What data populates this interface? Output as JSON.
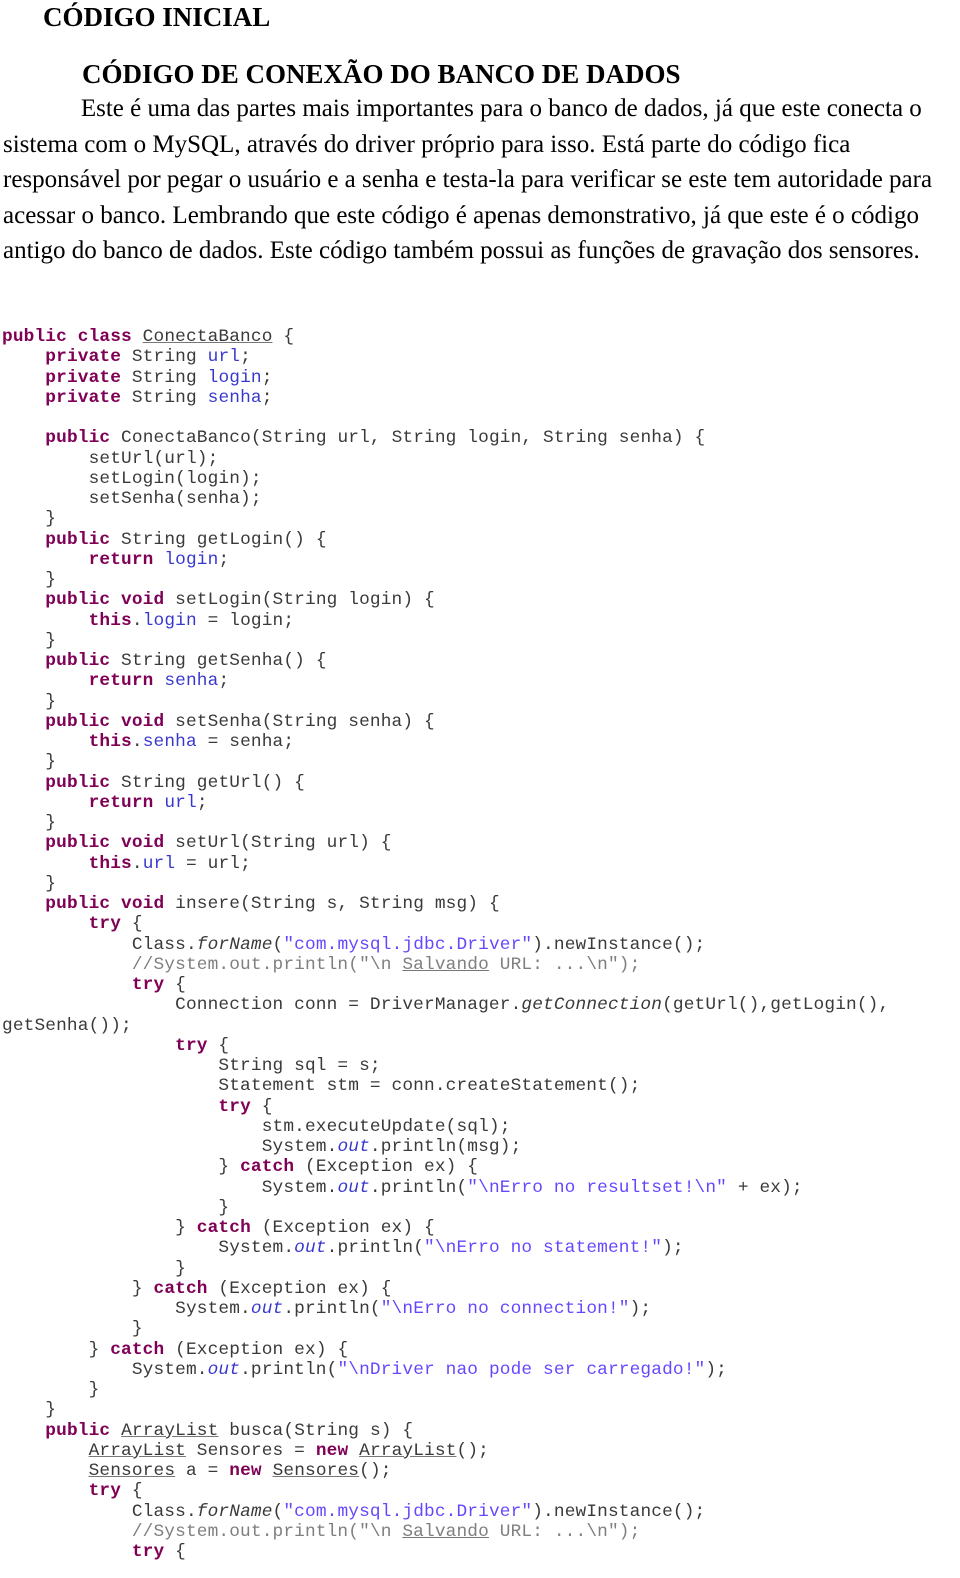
{
  "document": {
    "heading": "CÓDIGO INICIAL",
    "subheading": "CÓDIGO DE CONEXÃO DO BANCO DE DADOS",
    "paragraph": "Este é uma das partes mais importantes para o banco de dados, já que este conecta o sistema com o MySQL, através do driver próprio para isso. Está parte do código fica responsável por pegar o usuário e a senha e testa-la para verificar se este tem autoridade para acessar o banco. Lembrando que este código é apenas demonstrativo, já que este é o código antigo do banco de dados. Este código também possui as funções de gravação dos sensores."
  },
  "code": {
    "language": "java",
    "lines": [
      [
        {
          "t": "public class ",
          "c": "kw"
        },
        {
          "t": "ConectaBanco",
          "c": "ul"
        },
        {
          "t": " {"
        }
      ],
      [
        {
          "t": "    "
        },
        {
          "t": "private",
          "c": "kw"
        },
        {
          "t": " String "
        },
        {
          "t": "url",
          "c": "fld"
        },
        {
          "t": ";"
        }
      ],
      [
        {
          "t": "    "
        },
        {
          "t": "private",
          "c": "kw"
        },
        {
          "t": " String "
        },
        {
          "t": "login",
          "c": "fld"
        },
        {
          "t": ";"
        }
      ],
      [
        {
          "t": "    "
        },
        {
          "t": "private",
          "c": "kw"
        },
        {
          "t": " String "
        },
        {
          "t": "senha",
          "c": "fld"
        },
        {
          "t": ";"
        }
      ],
      [
        {
          "t": ""
        }
      ],
      [
        {
          "t": "    "
        },
        {
          "t": "public",
          "c": "kw"
        },
        {
          "t": " ConectaBanco(String url, String login, String senha) {"
        }
      ],
      [
        {
          "t": "        setUrl(url);"
        }
      ],
      [
        {
          "t": "        setLogin(login);"
        }
      ],
      [
        {
          "t": "        setSenha(senha);"
        }
      ],
      [
        {
          "t": "    }"
        }
      ],
      [
        {
          "t": "    "
        },
        {
          "t": "public",
          "c": "kw"
        },
        {
          "t": " String getLogin() {"
        }
      ],
      [
        {
          "t": "        "
        },
        {
          "t": "return",
          "c": "kw"
        },
        {
          "t": " "
        },
        {
          "t": "login",
          "c": "fld"
        },
        {
          "t": ";"
        }
      ],
      [
        {
          "t": "    }"
        }
      ],
      [
        {
          "t": "    "
        },
        {
          "t": "public void",
          "c": "kw"
        },
        {
          "t": " setLogin(String login) {"
        }
      ],
      [
        {
          "t": "        "
        },
        {
          "t": "this",
          "c": "kw"
        },
        {
          "t": "."
        },
        {
          "t": "login",
          "c": "fld"
        },
        {
          "t": " = login;"
        }
      ],
      [
        {
          "t": "    }"
        }
      ],
      [
        {
          "t": "    "
        },
        {
          "t": "public",
          "c": "kw"
        },
        {
          "t": " String getSenha() {"
        }
      ],
      [
        {
          "t": "        "
        },
        {
          "t": "return",
          "c": "kw"
        },
        {
          "t": " "
        },
        {
          "t": "senha",
          "c": "fld"
        },
        {
          "t": ";"
        }
      ],
      [
        {
          "t": "    }"
        }
      ],
      [
        {
          "t": "    "
        },
        {
          "t": "public void",
          "c": "kw"
        },
        {
          "t": " setSenha(String senha) {"
        }
      ],
      [
        {
          "t": "        "
        },
        {
          "t": "this",
          "c": "kw"
        },
        {
          "t": "."
        },
        {
          "t": "senha",
          "c": "fld"
        },
        {
          "t": " = senha;"
        }
      ],
      [
        {
          "t": "    }"
        }
      ],
      [
        {
          "t": "    "
        },
        {
          "t": "public",
          "c": "kw"
        },
        {
          "t": " String getUrl() {"
        }
      ],
      [
        {
          "t": "        "
        },
        {
          "t": "return",
          "c": "kw"
        },
        {
          "t": " "
        },
        {
          "t": "url",
          "c": "fld"
        },
        {
          "t": ";"
        }
      ],
      [
        {
          "t": "    }"
        }
      ],
      [
        {
          "t": "    "
        },
        {
          "t": "public void",
          "c": "kw"
        },
        {
          "t": " setUrl(String url) {"
        }
      ],
      [
        {
          "t": "        "
        },
        {
          "t": "this",
          "c": "kw"
        },
        {
          "t": "."
        },
        {
          "t": "url",
          "c": "fld"
        },
        {
          "t": " = url;"
        }
      ],
      [
        {
          "t": "    }"
        }
      ],
      [
        {
          "t": "    "
        },
        {
          "t": "public void",
          "c": "kw"
        },
        {
          "t": " insere(String s, String msg) {"
        }
      ],
      [
        {
          "t": "        "
        },
        {
          "t": "try",
          "c": "kw"
        },
        {
          "t": " {"
        }
      ],
      [
        {
          "t": "            Class."
        },
        {
          "t": "forName",
          "c": "it"
        },
        {
          "t": "("
        },
        {
          "t": "\"com.mysql.jdbc.Driver\"",
          "c": "str"
        },
        {
          "t": ").newInstance();"
        }
      ],
      [
        {
          "t": "            //System.out.println(\"\\n ",
          "c": "cmt"
        },
        {
          "t": "Salvando",
          "c": "cmt ul"
        },
        {
          "t": " URL: ...\\n\");",
          "c": "cmt"
        }
      ],
      [
        {
          "t": "            "
        },
        {
          "t": "try",
          "c": "kw"
        },
        {
          "t": " {"
        }
      ],
      [
        {
          "t": "                Connection conn = DriverManager."
        },
        {
          "t": "getConnection",
          "c": "it"
        },
        {
          "t": "(getUrl(),getLogin(),"
        }
      ],
      [
        {
          "t": "getSenha());"
        }
      ],
      [
        {
          "t": "                "
        },
        {
          "t": "try",
          "c": "kw"
        },
        {
          "t": " {"
        }
      ],
      [
        {
          "t": "                    String sql = s;"
        }
      ],
      [
        {
          "t": "                    Statement stm = conn.createStatement();"
        }
      ],
      [
        {
          "t": "                    "
        },
        {
          "t": "try",
          "c": "kw"
        },
        {
          "t": " {"
        }
      ],
      [
        {
          "t": "                        stm.executeUpdate(sql);"
        }
      ],
      [
        {
          "t": "                        System."
        },
        {
          "t": "out",
          "c": "fld it"
        },
        {
          "t": ".println(msg);"
        }
      ],
      [
        {
          "t": "                    } "
        },
        {
          "t": "catch",
          "c": "kw"
        },
        {
          "t": " (Exception ex) {"
        }
      ],
      [
        {
          "t": "                        System."
        },
        {
          "t": "out",
          "c": "fld it"
        },
        {
          "t": ".println("
        },
        {
          "t": "\"\\nErro no resultset!\\n\"",
          "c": "str"
        },
        {
          "t": " + ex);"
        }
      ],
      [
        {
          "t": "                    }"
        }
      ],
      [
        {
          "t": "                } "
        },
        {
          "t": "catch",
          "c": "kw"
        },
        {
          "t": " (Exception ex) {"
        }
      ],
      [
        {
          "t": "                    System."
        },
        {
          "t": "out",
          "c": "fld it"
        },
        {
          "t": ".println("
        },
        {
          "t": "\"\\nErro no statement!\"",
          "c": "str"
        },
        {
          "t": ");"
        }
      ],
      [
        {
          "t": "                }"
        }
      ],
      [
        {
          "t": "            } "
        },
        {
          "t": "catch",
          "c": "kw"
        },
        {
          "t": " (Exception ex) {"
        }
      ],
      [
        {
          "t": "                System."
        },
        {
          "t": "out",
          "c": "fld it"
        },
        {
          "t": ".println("
        },
        {
          "t": "\"\\nErro no connection!\"",
          "c": "str"
        },
        {
          "t": ");"
        }
      ],
      [
        {
          "t": "            }"
        }
      ],
      [
        {
          "t": "        } "
        },
        {
          "t": "catch",
          "c": "kw"
        },
        {
          "t": " (Exception ex) {"
        }
      ],
      [
        {
          "t": "            System."
        },
        {
          "t": "out",
          "c": "fld it"
        },
        {
          "t": ".println("
        },
        {
          "t": "\"\\nDriver nao pode ser carregado!\"",
          "c": "str"
        },
        {
          "t": ");"
        }
      ],
      [
        {
          "t": "        }"
        }
      ],
      [
        {
          "t": "    }"
        }
      ],
      [
        {
          "t": "    "
        },
        {
          "t": "public",
          "c": "kw"
        },
        {
          "t": " "
        },
        {
          "t": "ArrayList",
          "c": "ul"
        },
        {
          "t": " busca(String s) {"
        }
      ],
      [
        {
          "t": "        "
        },
        {
          "t": "ArrayList",
          "c": "ul"
        },
        {
          "t": " Sensores = "
        },
        {
          "t": "new",
          "c": "kw"
        },
        {
          "t": " "
        },
        {
          "t": "ArrayList",
          "c": "ul"
        },
        {
          "t": "();"
        }
      ],
      [
        {
          "t": "        "
        },
        {
          "t": "Sensores",
          "c": "ul"
        },
        {
          "t": " a = "
        },
        {
          "t": "new",
          "c": "kw"
        },
        {
          "t": " "
        },
        {
          "t": "Sensores",
          "c": "ul"
        },
        {
          "t": "();"
        }
      ],
      [
        {
          "t": "        "
        },
        {
          "t": "try",
          "c": "kw"
        },
        {
          "t": " {"
        }
      ],
      [
        {
          "t": "            Class."
        },
        {
          "t": "forName",
          "c": "it"
        },
        {
          "t": "("
        },
        {
          "t": "\"com.mysql.jdbc.Driver\"",
          "c": "str"
        },
        {
          "t": ").newInstance();"
        }
      ],
      [
        {
          "t": "            //System.out.println(\"\\n ",
          "c": "cmt"
        },
        {
          "t": "Salvando",
          "c": "cmt ul"
        },
        {
          "t": " URL: ...\\n\");",
          "c": "cmt"
        }
      ],
      [
        {
          "t": "            "
        },
        {
          "t": "try",
          "c": "kw"
        },
        {
          "t": " {"
        }
      ]
    ]
  }
}
